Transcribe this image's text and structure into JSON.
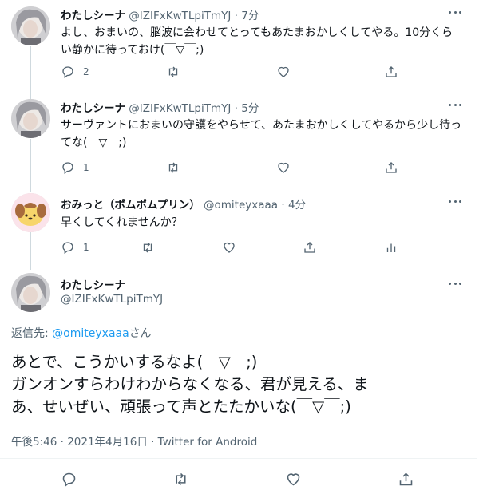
{
  "colors": {
    "text": "#0f1419",
    "muted": "#536471",
    "link": "#1d9bf0",
    "thread": "#cfd9de",
    "divider": "#eff3f4"
  },
  "tweets": [
    {
      "name": "わたしシーナ",
      "handle": "@IZIFxKwTLpiTmYJ",
      "time": "· 7分",
      "text": "よし、おまいの、脳波に会わせてとってもあたまおかしくしてやる。10分くらい静かに待っておけ(￣▽￣;)",
      "reply_count": "2"
    },
    {
      "name": "わたしシーナ",
      "handle": "@IZIFxKwTLpiTmYJ",
      "time": "· 5分",
      "text": "サーヴァントにおまいの守護をやらせて、あたまおかしくしてやるから少し待ってな(￣▽￣;)",
      "reply_count": "1"
    },
    {
      "name": "おみっと（ポムポムプリン）",
      "handle": "@omiteyxaaa",
      "time": "· 4分",
      "text": "早くしてくれませんか？",
      "reply_count": "1"
    }
  ],
  "main": {
    "name": "わたしシーナ",
    "handle": "@IZIFxKwTLpiTmYJ",
    "reply_to_prefix": "返信先: ",
    "reply_to_handle": "@omiteyxaaa",
    "reply_to_suffix": "さん",
    "text_line1": "あとで、こうかいするなよ(￣▽￣;)",
    "text_line2": "ガンオンすらわけわからなくなる、君が見える、ま",
    "text_line3": "あ、せいぜい、頑張って声とたたかいな(￣▽￣;)",
    "timestamp": "午後5:46 · 2021年4月16日 · Twitter for Android"
  }
}
